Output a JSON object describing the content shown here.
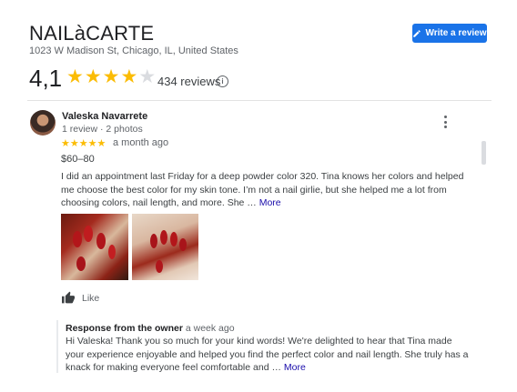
{
  "business": {
    "name": "NAILàCARTE",
    "address": "1023 W Madison St, Chicago, IL, United States",
    "rating": "4,1",
    "rating_value": 4.1,
    "reviews_count": "434 reviews",
    "write_review_label": "Write a review"
  },
  "colors": {
    "accent": "#1a73e8",
    "star": "#fbbc04",
    "star_empty": "#dadce0",
    "link": "#1a0dab"
  },
  "review": {
    "author": "Valeska Navarrete",
    "meta": "1 review · 2 photos",
    "stars": 5,
    "time": "a month ago",
    "price": "$60–80",
    "text": "I did an appointment last Friday for a deep powder  color 320. Tina knows her colors and helped me choose the best color for my skin tone.  I’m not a nail girlie, but she helped me a lot from choosing colors, nail length, and more. She … ",
    "more_label": "More",
    "like_label": "Like",
    "icons": {
      "menu": "more-vert-icon",
      "like": "thumb-up-icon",
      "info": "info-icon"
    }
  },
  "owner_response": {
    "title": "Response from the owner",
    "time": "a week ago",
    "text": "Hi Valeska! Thank you so much for your kind words! We're delighted to hear that Tina made your experience enjoyable and helped you find the perfect color and nail length. She truly has a knack for making everyone feel comfortable and … ",
    "more_label": "More"
  }
}
